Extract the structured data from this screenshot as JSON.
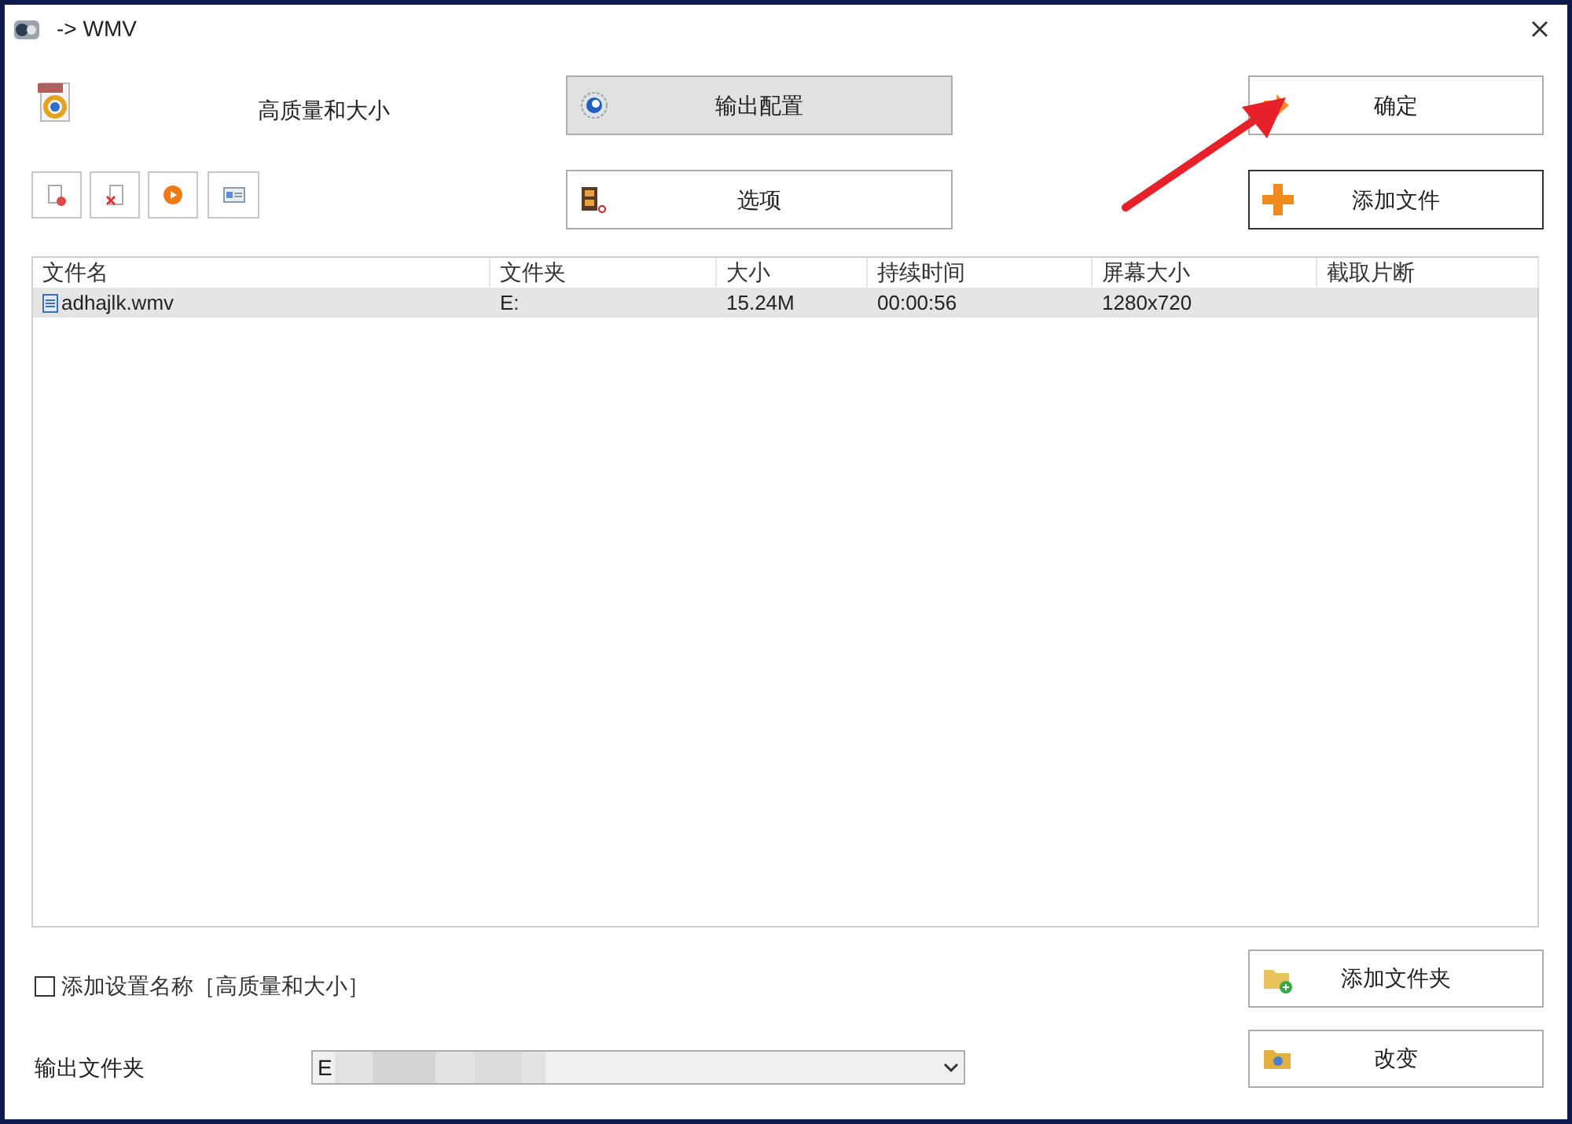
{
  "window": {
    "title": "-> WMV"
  },
  "profile": {
    "label": "高质量和大小"
  },
  "buttons": {
    "output_config": "输出配置",
    "options": "选项",
    "ok": "确定",
    "add_file": "添加文件",
    "add_folder": "添加文件夹",
    "change": "改变"
  },
  "table": {
    "columns": [
      "文件名",
      "文件夹",
      "大小",
      "持续时间",
      "屏幕大小",
      "截取片断"
    ],
    "rows": [
      {
        "cells": [
          "adhajlk.wmv",
          "E:",
          "15.24M",
          "00:00:56",
          "1280x720",
          ""
        ],
        "selected": true
      }
    ]
  },
  "name_setting": {
    "label": "添加设置名称［高质量和大小］",
    "checked": false
  },
  "output_folder": {
    "label": "输出文件夹",
    "value": "E"
  }
}
